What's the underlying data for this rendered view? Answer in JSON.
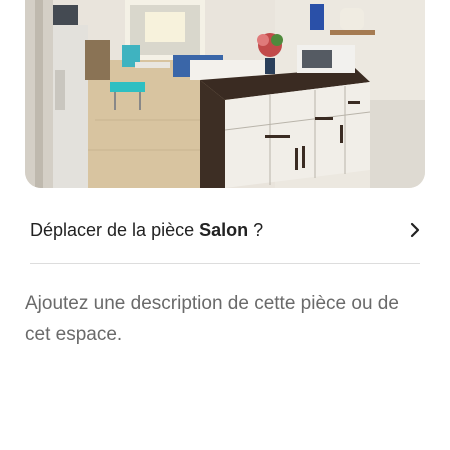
{
  "photo": {
    "alt_icon": "room-photo"
  },
  "move_room": {
    "prefix": "Déplacer de la pièce",
    "room_name": "Salon",
    "suffix": "?",
    "chevron_icon": "chevron-right-icon"
  },
  "description": {
    "placeholder": "Ajoutez une description de cette pièce ou de cet espace."
  }
}
